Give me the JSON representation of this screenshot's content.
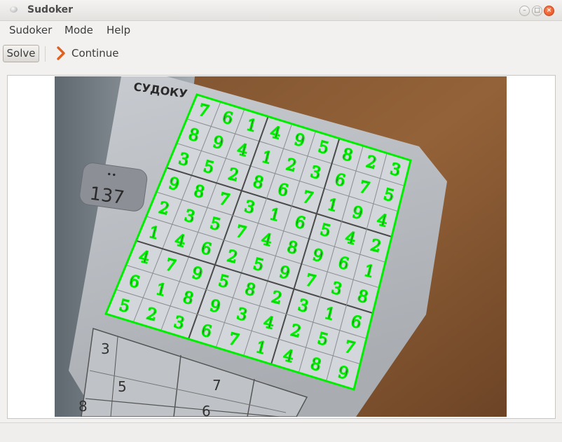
{
  "window": {
    "title": "Sudoker"
  },
  "menu": {
    "items": [
      "Sudoker",
      "Mode",
      "Help"
    ]
  },
  "toolbar": {
    "solve_label": "Solve",
    "continue_label": "Continue"
  },
  "photo": {
    "header_text": "СУДОКУ",
    "puzzle_number": "137",
    "badge_marks": "••",
    "overlay_color": "#00ee00"
  },
  "sudoku": {
    "rows": [
      [
        "7",
        "6",
        "1",
        "4",
        "9",
        "5",
        "8",
        "2",
        "3"
      ],
      [
        "8",
        "9",
        "4",
        "1",
        "2",
        "3",
        "6",
        "7",
        "5"
      ],
      [
        "3",
        "5",
        "2",
        "8",
        "6",
        "7",
        "1",
        "9",
        "4"
      ],
      [
        "9",
        "8",
        "7",
        "3",
        "1",
        "6",
        "5",
        "4",
        "2"
      ],
      [
        "2",
        "3",
        "5",
        "7",
        "4",
        "8",
        "9",
        "6",
        "1"
      ],
      [
        "1",
        "4",
        "6",
        "2",
        "5",
        "9",
        "7",
        "3",
        "8"
      ],
      [
        "4",
        "7",
        "9",
        "5",
        "8",
        "2",
        "3",
        "1",
        "6"
      ],
      [
        "6",
        "1",
        "8",
        "9",
        "3",
        "4",
        "2",
        "5",
        "7"
      ],
      [
        "5",
        "2",
        "3",
        "6",
        "7",
        "1",
        "4",
        "8",
        "9"
      ]
    ]
  },
  "lower_grid": {
    "visible_digits": [
      "3",
      "5",
      "7",
      "8",
      "6"
    ]
  }
}
